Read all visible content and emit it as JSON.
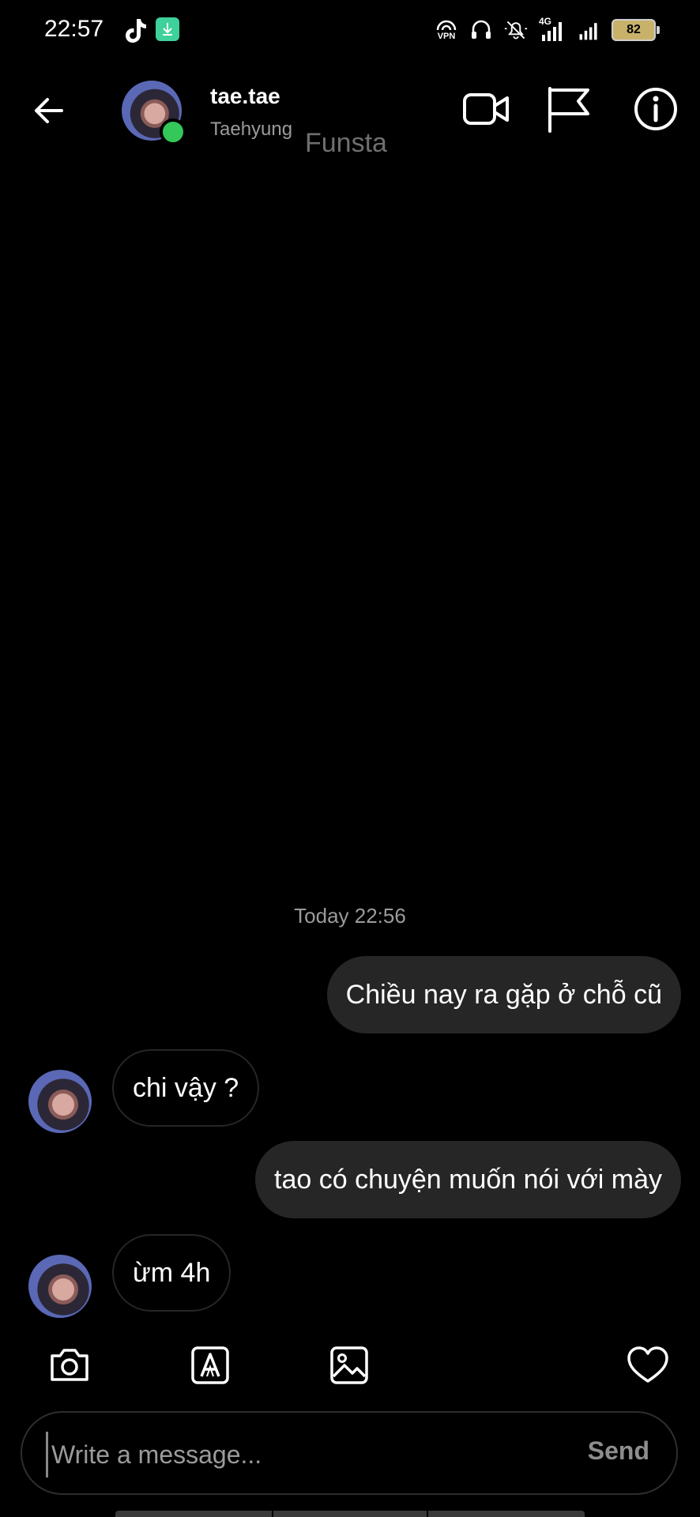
{
  "status_bar": {
    "time": "22:57",
    "battery": "82",
    "icons": [
      "tiktok-icon",
      "download-icon",
      "vpn-icon",
      "headset-icon",
      "mute-bell-icon",
      "signal-4g-icon",
      "signal-icon",
      "battery-icon"
    ],
    "vpn_label": "VPN",
    "network_label": "4G"
  },
  "header": {
    "username": "tae.tae",
    "subtitle": "Taehyung",
    "watermark": "Funsta",
    "online": true,
    "online_color": "#34c759"
  },
  "conversation": {
    "timestamp": "Today 22:56",
    "messages": [
      {
        "direction": "outgoing",
        "text": "Chiều nay ra gặp ở chỗ cũ"
      },
      {
        "direction": "incoming",
        "text": "chi vậy ?"
      },
      {
        "direction": "outgoing",
        "text": "tao có chuyện muốn nói với mày"
      },
      {
        "direction": "incoming",
        "text": "ừm 4h"
      }
    ]
  },
  "composer": {
    "placeholder": "Write a message...",
    "value": "",
    "send_label": "Send"
  },
  "toolbar": {
    "icons": [
      "camera-icon",
      "text-style-icon",
      "gallery-icon",
      "heart-icon"
    ]
  },
  "colors": {
    "background": "#000000",
    "outgoing_bubble": "#262626",
    "incoming_border": "#262626",
    "muted_text": "#9b9b9b"
  }
}
